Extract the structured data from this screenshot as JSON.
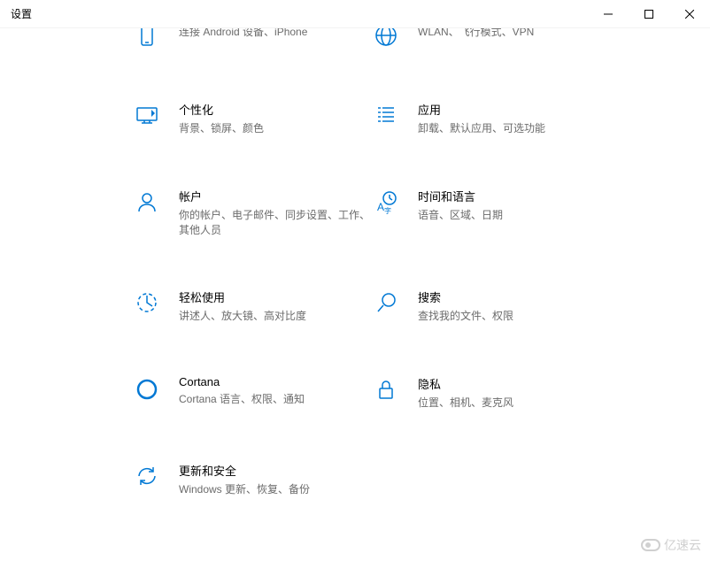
{
  "window": {
    "title": "设置",
    "minimize": "—",
    "maximize": "☐",
    "close": "✕"
  },
  "categories": [
    {
      "id": "phone",
      "title": "",
      "desc": "连接 Android 设备、iPhone"
    },
    {
      "id": "network",
      "title": "",
      "desc": "WLAN、飞行模式、VPN"
    },
    {
      "id": "personalization",
      "title": "个性化",
      "desc": "背景、锁屏、颜色"
    },
    {
      "id": "apps",
      "title": "应用",
      "desc": "卸载、默认应用、可选功能"
    },
    {
      "id": "accounts",
      "title": "帐户",
      "desc": "你的帐户、电子邮件、同步设置、工作、其他人员"
    },
    {
      "id": "time",
      "title": "时间和语言",
      "desc": "语音、区域、日期"
    },
    {
      "id": "ease",
      "title": "轻松使用",
      "desc": "讲述人、放大镜、高对比度"
    },
    {
      "id": "search",
      "title": "搜索",
      "desc": "查找我的文件、权限"
    },
    {
      "id": "cortana",
      "title": "Cortana",
      "desc": "Cortana 语言、权限、通知"
    },
    {
      "id": "privacy",
      "title": "隐私",
      "desc": "位置、相机、麦克风"
    },
    {
      "id": "update",
      "title": "更新和安全",
      "desc": "Windows 更新、恢复、备份"
    }
  ],
  "watermark": "亿速云"
}
